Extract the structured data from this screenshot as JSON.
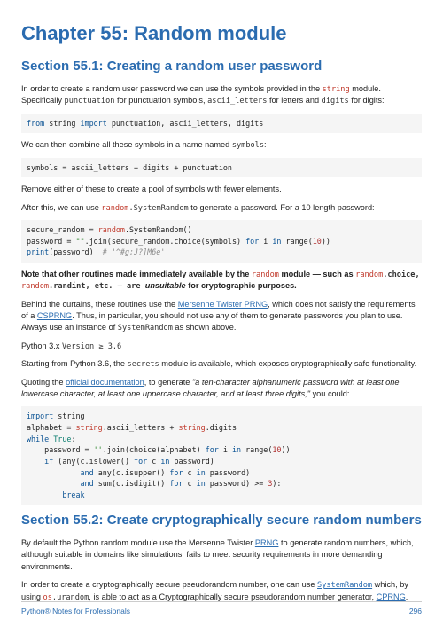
{
  "chapter_title": "Chapter 55: Random module",
  "section1_title": "Section 55.1: Creating a random user password",
  "p1a": "In order to create a random user password we can use the symbols provided in the ",
  "p1b": " module. Specifically ",
  "p1c": " for punctuation symbols, ",
  "p1d": " for letters and ",
  "p1e": " for digits:",
  "inline_string": "string",
  "inline_punctuation": "punctuation",
  "inline_ascii_letters": "ascii_letters",
  "inline_digits": "digits",
  "p2": "We can then combine all these symbols in a name named ",
  "inline_symbols": "symbols",
  "p3": "Remove either of these to create a pool of symbols with fewer elements.",
  "p4a": "After this, we can use ",
  "inline_random": "random",
  "p4b": " to generate a password. For a 10 length password:",
  "inline_sysrandom": ".SystemRandom",
  "note_a": "Note that other routines made immediately available by the ",
  "note_b": " module — such as ",
  "note_c": ".choice, ",
  "note_d": ".randint, etc. — are ",
  "note_e": "unsuitable",
  "note_f": " for cryptographic purposes.",
  "p5a": "Behind the curtains, these routines use the ",
  "link_mersenne": "Mersenne Twister PRNG",
  "p5b": ", which does not satisfy the requirements of a ",
  "link_csprng": "CSPRNG",
  "p5c": ". Thus, in particular, you should not use any of them to generate passwords you plan to use. Always use an instance of ",
  "inline_systemrandom2": "SystemRandom",
  "p5d": " as shown above.",
  "p6": "Python 3.x ",
  "p6b": "Version ≥ 3.6",
  "p7a": "Starting from Python 3.6, the ",
  "inline_secrets": "secrets",
  "p7b": " module is available, which exposes cryptographically safe functionality.",
  "p8a": "Quoting the ",
  "link_docs": "official documentation",
  "p8b": ", to generate ",
  "p8c": "\"a ten-character alphanumeric password with at least one lowercase character, at least one uppercase character, and at least three digits,\"",
  "p8d": " you could:",
  "section2_title": "Section 55.2: Create cryptographically secure random numbers",
  "p9a": "By default the Python random module use the Mersenne Twister ",
  "link_prng": "PRNG",
  "p9b": " to generate random numbers, which, although suitable in domains like simulations, fails to meet security requirements in more demanding environments.",
  "p10a": "In order to create a cryptographically secure pseudorandom number, one can use ",
  "link_sysrandom": "SystemRandom",
  "p10b": " which, by using ",
  "inline_os": "os",
  "inline_urandom": ".urandom",
  "p10c": ", is able to act as a Cryptographically secure pseudorandom number generator, ",
  "link_cprng2": "CPRNG",
  "footer_left": "Python® Notes for Professionals",
  "footer_right": "296"
}
